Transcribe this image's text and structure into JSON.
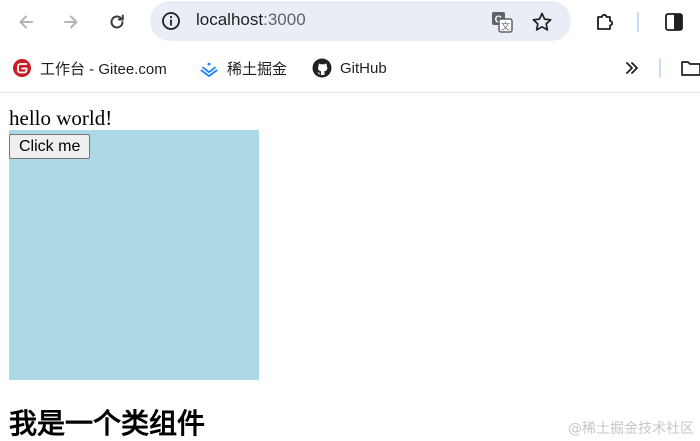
{
  "browser": {
    "url_host": "localhost",
    "url_port": ":3000",
    "icons": {
      "back": "arrow-left-icon",
      "forward": "arrow-right-icon",
      "reload": "reload-icon",
      "site_info": "info-icon",
      "translate": "translate-icon",
      "bookmark": "star-icon",
      "extensions": "puzzle-icon",
      "side_panel": "side-panel-icon",
      "bookmarks_overflow": "double-chevron-icon",
      "folder": "folder-icon"
    }
  },
  "bookmarks": [
    {
      "label": "工作台 - Gitee.com",
      "icon": "gitee-icon",
      "color": "#c71d23"
    },
    {
      "label": "稀土掘金",
      "icon": "juejin-icon",
      "color": "#1e80ff"
    },
    {
      "label": "GitHub",
      "icon": "github-icon",
      "color": "#1f2328"
    }
  ],
  "page": {
    "greeting": "hello world!",
    "button_label": "Click me",
    "box_color": "#add8e6",
    "heading": "我是一个类组件"
  },
  "watermark": "@稀土掘金技术社区"
}
